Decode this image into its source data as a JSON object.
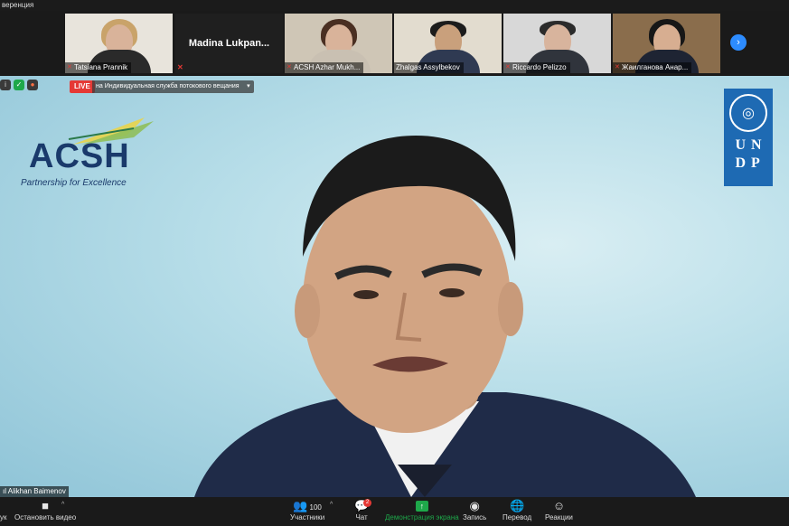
{
  "window": {
    "title": "веренция"
  },
  "participants": [
    {
      "name": "Tatsiana Prannik"
    },
    {
      "name": "Madina  Lukpan..."
    },
    {
      "name": "ACSH Azhar Mukh..."
    },
    {
      "name": "Zhalgas Assylbekov"
    },
    {
      "name": "Riccardo Pelizzo"
    },
    {
      "name": "Жаилганова Анар..."
    }
  ],
  "live": {
    "badge": "LIVE",
    "text": "на Индивидуальная служба потокового вещания"
  },
  "main": {
    "acsh_word": "ACSH",
    "acsh_tag": "Partnership for Excellence",
    "undp_letters": [
      "U",
      "N",
      "D",
      "P"
    ],
    "speaker_name": "Alikhan Baimenov"
  },
  "toolbar": {
    "audio_label": "ук",
    "video_label": "Остановить видео",
    "participants_label": "Участники",
    "participants_count": "100",
    "chat_label": "Чат",
    "chat_badge": "2",
    "share_label": "Демонстрация экрана",
    "record_label": "Запись",
    "translate_label": "Перевод",
    "reactions_label": "Реакции"
  },
  "colors": {
    "accent_blue": "#2d8cff",
    "live_red": "#e53935",
    "share_green": "#1ea84a",
    "undp_blue": "#1e6ab3",
    "acsh_navy": "#1a3a6b"
  }
}
